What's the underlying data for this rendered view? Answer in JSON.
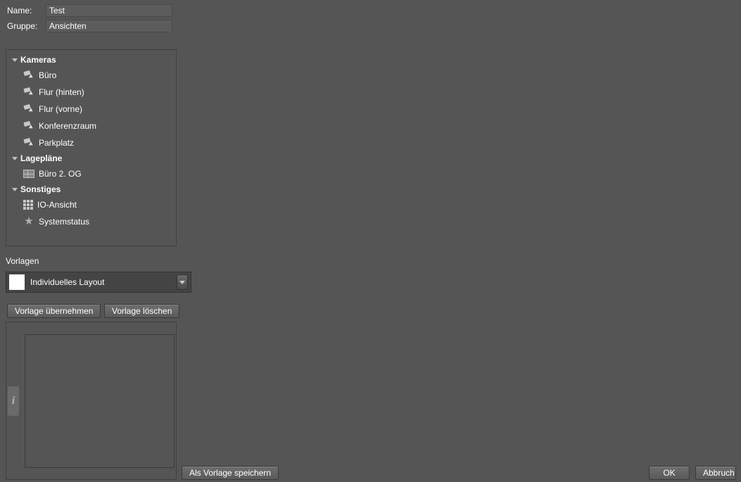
{
  "form": {
    "name_label": "Name:",
    "name_value": "Test",
    "group_label": "Gruppe:",
    "group_value": "Ansichten"
  },
  "tree": {
    "groups": [
      {
        "label": "Kameras",
        "items": [
          {
            "icon": "camera",
            "label": "Büro"
          },
          {
            "icon": "camera",
            "label": "Flur (hinten)"
          },
          {
            "icon": "camera",
            "label": "Flur (vorne)"
          },
          {
            "icon": "camera",
            "label": "Konferenzraum"
          },
          {
            "icon": "camera",
            "label": "Parkplatz"
          }
        ]
      },
      {
        "label": "Lagepläne",
        "items": [
          {
            "icon": "plan",
            "label": "Büro 2. OG"
          }
        ]
      },
      {
        "label": "Sonstiges",
        "items": [
          {
            "icon": "grid",
            "label": "IO-Ansicht"
          },
          {
            "icon": "star",
            "label": "Systemstatus"
          }
        ]
      }
    ]
  },
  "templates": {
    "section_label": "Vorlagen",
    "selected": "Individuelles Layout"
  },
  "buttons": {
    "apply_template": "Vorlage übernehmen",
    "delete_template": "Vorlage löschen",
    "save_as_template": "Als Vorlage speichern",
    "ok": "OK",
    "cancel": "Abbruch"
  },
  "info_glyph": "i"
}
